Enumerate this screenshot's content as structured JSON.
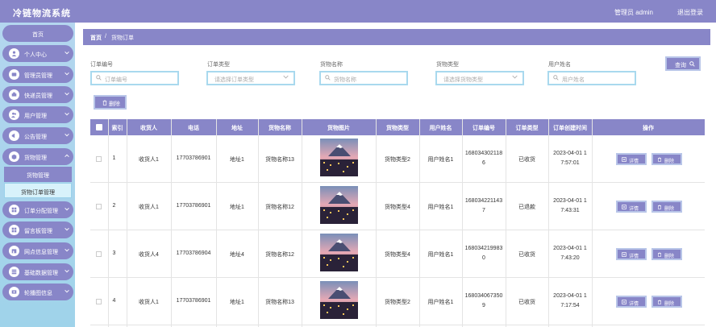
{
  "app": {
    "title": "冷链物流系统",
    "user": "管理员 admin",
    "logout": "退出登录"
  },
  "sidebar": {
    "items": [
      {
        "label": "首页",
        "icon": "home-icon"
      },
      {
        "label": "个人中心",
        "icon": "user-icon"
      },
      {
        "label": "管理员管理",
        "icon": "admin-icon"
      },
      {
        "label": "快递员管理",
        "icon": "courier-icon"
      },
      {
        "label": "用户管理",
        "icon": "users-icon"
      },
      {
        "label": "公告管理",
        "icon": "notice-icon"
      },
      {
        "label": "货物管理",
        "icon": "goods-icon"
      },
      {
        "label": "订单分配管理",
        "icon": "assign-icon"
      },
      {
        "label": "留言板管理",
        "icon": "message-icon"
      },
      {
        "label": "网点信息管理",
        "icon": "outlet-icon"
      },
      {
        "label": "基础数据管理",
        "icon": "data-icon"
      },
      {
        "label": "轮播图信息",
        "icon": "carousel-icon"
      }
    ],
    "sub_items": [
      {
        "label": "货物管理"
      },
      {
        "label": "货物订单管理"
      }
    ]
  },
  "breadcrumb": {
    "home": "首页",
    "sep": "/",
    "current": "货物订单"
  },
  "filters": {
    "order_no": {
      "label": "订单编号",
      "placeholder": "订单编号"
    },
    "order_type": {
      "label": "订单类型",
      "placeholder": "请选择订单类型"
    },
    "goods_name": {
      "label": "货物名称",
      "placeholder": "货物名称"
    },
    "goods_type": {
      "label": "货物类型",
      "placeholder": "请选择货物类型"
    },
    "user_name": {
      "label": "用户姓名",
      "placeholder": "用户姓名"
    },
    "search_label": "查询",
    "delete_label": "删除"
  },
  "table": {
    "headers": [
      "索引",
      "收货人",
      "电话",
      "地址",
      "货物名称",
      "货物图片",
      "货物类型",
      "用户姓名",
      "订单编号",
      "订单类型",
      "订单创建时间",
      "操作"
    ],
    "detail_label": "详情",
    "delete_label": "删除",
    "rows": [
      {
        "index": "1",
        "receiver": "收货人1",
        "phone": "17703786901",
        "address": "地址1",
        "goods_name": "货物名称13",
        "goods_type": "货物类型2",
        "user_name": "用户姓名1",
        "order_no_1": "168034302118",
        "order_no_2": "6",
        "order_type": "已收货",
        "created_1": "2023-04-01 1",
        "created_2": "7:57:01"
      },
      {
        "index": "2",
        "receiver": "收货人1",
        "phone": "17703786901",
        "address": "地址1",
        "goods_name": "货物名称12",
        "goods_type": "货物类型4",
        "user_name": "用户姓名1",
        "order_no_1": "168034221143",
        "order_no_2": "7",
        "order_type": "已退款",
        "created_1": "2023-04-01 1",
        "created_2": "7:43:31"
      },
      {
        "index": "3",
        "receiver": "收货人4",
        "phone": "17703786904",
        "address": "地址4",
        "goods_name": "货物名称12",
        "goods_type": "货物类型4",
        "user_name": "用户姓名1",
        "order_no_1": "168034219983",
        "order_no_2": "0",
        "order_type": "已收货",
        "created_1": "2023-04-01 1",
        "created_2": "7:43:20"
      },
      {
        "index": "4",
        "receiver": "收货人1",
        "phone": "17703786901",
        "address": "地址1",
        "goods_name": "货物名称13",
        "goods_type": "货物类型2",
        "user_name": "用户姓名1",
        "order_no_1": "168034067350",
        "order_no_2": "9",
        "order_type": "已收货",
        "created_1": "2023-04-01 1",
        "created_2": "7:17:54"
      }
    ]
  },
  "colors": {
    "primary": "#8886c8",
    "sidebar_bg": "#a9d6ee",
    "input_border": "#a9d9ee"
  }
}
